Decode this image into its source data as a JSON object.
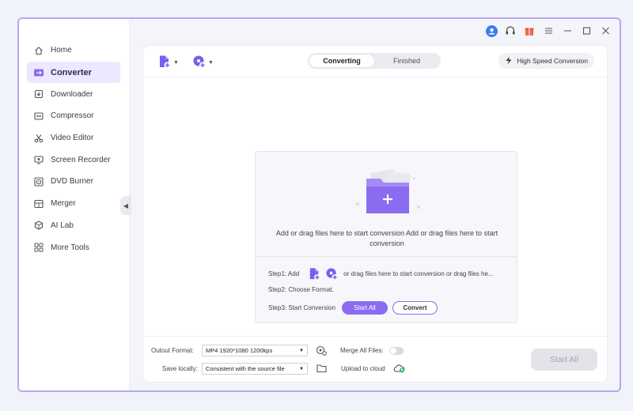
{
  "sidebar": {
    "items": [
      {
        "label": "Home",
        "icon": "home-icon"
      },
      {
        "label": "Converter",
        "icon": "converter-icon"
      },
      {
        "label": "Downloader",
        "icon": "downloader-icon"
      },
      {
        "label": "Compressor",
        "icon": "compressor-icon"
      },
      {
        "label": "Video Editor",
        "icon": "scissors-icon"
      },
      {
        "label": "Screen Recorder",
        "icon": "screen-recorder-icon"
      },
      {
        "label": "DVD Burner",
        "icon": "dvd-icon"
      },
      {
        "label": "Merger",
        "icon": "merger-icon"
      },
      {
        "label": "AI Lab",
        "icon": "ai-lab-icon"
      },
      {
        "label": "More Tools",
        "icon": "grid-icon"
      }
    ],
    "active_index": 1
  },
  "tabs": [
    {
      "label": "Converting",
      "active": true
    },
    {
      "label": "Finished",
      "active": false
    }
  ],
  "toolbar": {
    "high_speed_label": "High Speed Conversion"
  },
  "drop_zone": {
    "text": "Add or drag files here to start conversion Add or drag files here to start conversion",
    "step1_label": "Step1:  Add",
    "step1_trail": "or drag files here to start conversion or drag files he...",
    "step2_label": "Step2: Choose Format.",
    "step3_label": "Step3: Start Conversion",
    "start_all_label": "Start All",
    "convert_label": "Convert"
  },
  "bottom": {
    "output_format_label": "Outout Format:",
    "output_format_value": "MP4 1920*1080 1200kps",
    "save_locally_label": "Save locally:",
    "save_locally_value": "Consistent with the source file",
    "merge_label": "Merge All Files:",
    "upload_label": "Upload to cloud",
    "start_all_label": "Start All"
  },
  "colors": {
    "accent": "#8b6cf0",
    "window_border": "#b6a8ee",
    "active_nav_bg": "#ece8ff"
  }
}
